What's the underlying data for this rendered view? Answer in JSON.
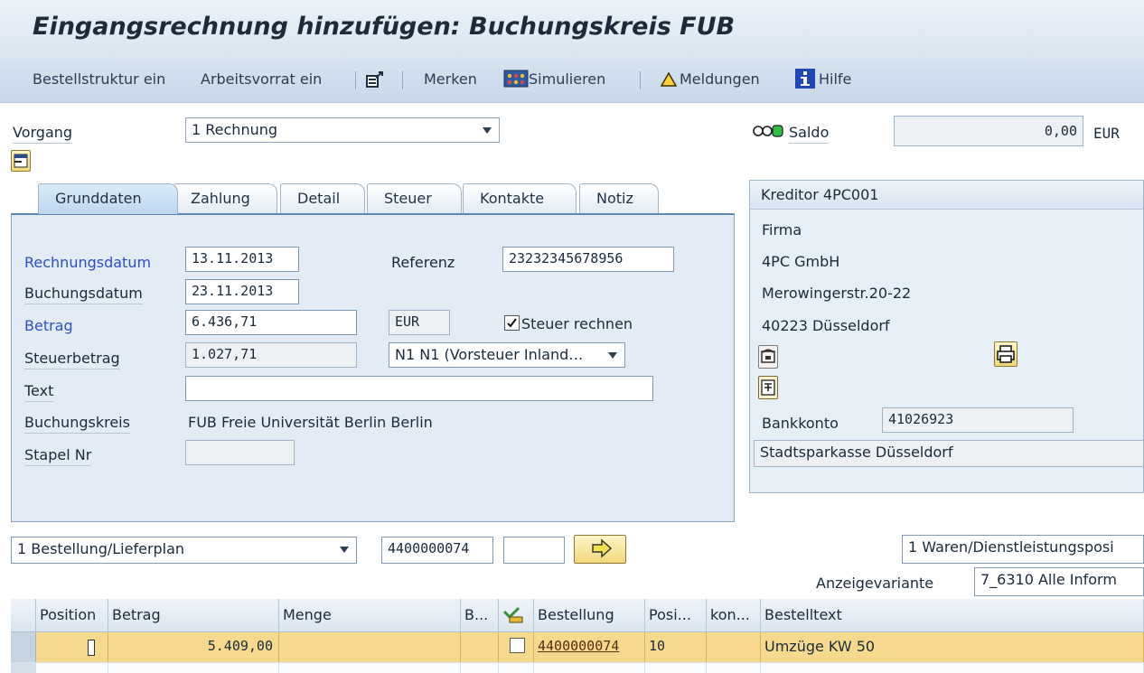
{
  "window": {
    "title": "Eingangsrechnung hinzufügen: Buchungskreis FUB"
  },
  "toolbar": {
    "bestellstruktur": "Bestellstruktur ein",
    "arbeitsvorrat": "Arbeitsvorrat ein",
    "merken": "Merken",
    "simulieren": "Simulieren",
    "meldungen": "Meldungen",
    "hilfe": "Hilfe"
  },
  "header": {
    "vorgang_label": "Vorgang",
    "vorgang_value": "1 Rechnung",
    "saldo_label": "Saldo",
    "saldo_value": "0,00",
    "saldo_currency": "EUR"
  },
  "tabs": [
    "Grunddaten",
    "Zahlung",
    "Detail",
    "Steuer",
    "Kontakte",
    "Notiz"
  ],
  "grunddaten": {
    "rechnungsdatum_label": "Rechnungsdatum",
    "rechnungsdatum_value": "13.11.2013",
    "referenz_label": "Referenz",
    "referenz_value": "23232345678956",
    "buchungsdatum_label": "Buchungsdatum",
    "buchungsdatum_value": "23.11.2013",
    "betrag_label": "Betrag",
    "betrag_value": "6.436,71",
    "betrag_currency": "EUR",
    "steuer_rechnen_label": "Steuer rechnen",
    "steuerbetrag_label": "Steuerbetrag",
    "steuerbetrag_value": "1.027,71",
    "steuerkennz_value": "N1 N1 (Vorsteuer Inland…",
    "text_label": "Text",
    "text_value": "",
    "buchungskreis_label": "Buchungskreis",
    "buchungskreis_value": "FUB Freie Universität Berlin Berlin",
    "stapel_label": "Stapel Nr",
    "stapel_value": ""
  },
  "vendor": {
    "header": "Kreditor 4PC001",
    "anrede": "Firma",
    "name": "4PC GmbH",
    "street": "Merowingerstr.20-22",
    "city": "40223 Düsseldorf",
    "bankkonto_label": "Bankkonto",
    "bankkonto_value": "41026923",
    "bank_name": "Stadtsparkasse Düsseldorf"
  },
  "reference": {
    "type_value": "1 Bestellung/Lieferplan",
    "bestellnr_value": "4400000074",
    "extra_value": "",
    "positions_value": "1 Waren/Dienstleistungsposi",
    "anzeigevariante_label": "Anzeigevariante",
    "anzeigevariante_value": "7_6310 Alle Inform"
  },
  "grid": {
    "columns": [
      "Position",
      "Betrag",
      "Menge",
      "B...",
      "",
      "Bestellung",
      "Posi...",
      "kon...",
      "Bestelltext"
    ],
    "rows": [
      {
        "betrag": "5.409,00",
        "menge": "",
        "bestellung": "4400000074",
        "posi": "10",
        "bestelltext": "Umzüge KW 50"
      }
    ]
  }
}
